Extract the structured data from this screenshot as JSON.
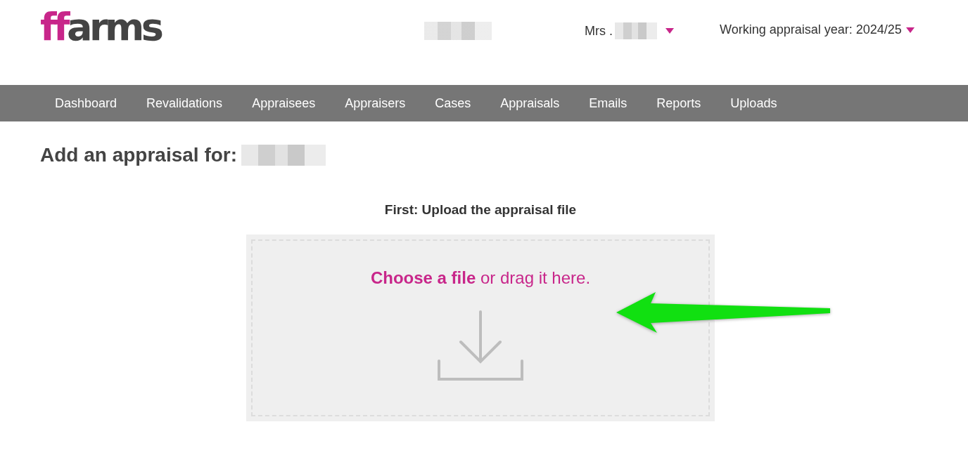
{
  "logo": {
    "accent": "ff",
    "rest": "arms"
  },
  "user_menu": {
    "label": "Mrs ."
  },
  "year_menu": {
    "label": "Working appraisal year: 2024/25"
  },
  "nav": [
    "Dashboard",
    "Revalidations",
    "Appraisees",
    "Appraisers",
    "Cases",
    "Appraisals",
    "Emails",
    "Reports",
    "Uploads"
  ],
  "page": {
    "title": "Add an appraisal for:",
    "step_heading": "First: Upload the appraisal file",
    "dropzone": {
      "link": "Choose a file",
      "text": "or drag it here."
    }
  }
}
